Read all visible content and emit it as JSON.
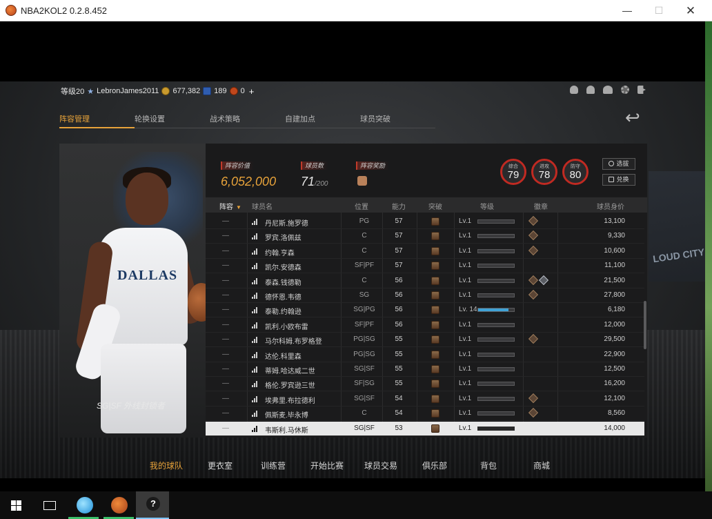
{
  "window": {
    "title": "NBA2KOL2 0.2.8.452",
    "minimize": "—",
    "maximize": "☐",
    "close": "✕"
  },
  "status": {
    "level": "等级20",
    "username": "LebronJames2011",
    "gold": "677,382",
    "stars": "189",
    "tokens": "0",
    "plus": "+"
  },
  "tabs": [
    {
      "label": "阵容管理"
    },
    {
      "label": "轮换设置"
    },
    {
      "label": "战术策略"
    },
    {
      "label": "自建加点"
    },
    {
      "label": "球员突破"
    }
  ],
  "player_card": {
    "jersey": "DALLAS",
    "role": "SG|SF 外线封锁者"
  },
  "summary": {
    "value_label": "阵容价值",
    "value": "6,052,000",
    "count_label": "球员数",
    "count": "71",
    "count_max": "/200",
    "reward_label": "阵容奖励"
  },
  "gauges": [
    {
      "label": "综合",
      "value": "79"
    },
    {
      "label": "进攻",
      "value": "78"
    },
    {
      "label": "防守",
      "value": "80"
    }
  ],
  "buttons": {
    "select": "选拔",
    "exchange": "兑换"
  },
  "table_headers": {
    "lineup": "阵容",
    "name": "球员名",
    "position": "位置",
    "ability": "能力",
    "breakthrough": "突破",
    "grade": "等级",
    "badge": "徽章",
    "value": "球员身价"
  },
  "rows": [
    {
      "dash": "—",
      "name": "丹尼斯.施罗德",
      "pos": "PG",
      "ovr": "57",
      "lvl": "Lv.1",
      "bar": 0,
      "badges": [
        "bronze"
      ],
      "salary": "13,100"
    },
    {
      "dash": "—",
      "name": "罗宾.洛佩兹",
      "pos": "C",
      "ovr": "57",
      "lvl": "Lv.1",
      "bar": 0,
      "badges": [
        "bronze"
      ],
      "salary": "9,330"
    },
    {
      "dash": "—",
      "name": "约翰.亨森",
      "pos": "C",
      "ovr": "57",
      "lvl": "Lv.1",
      "bar": 0,
      "badges": [
        "bronze"
      ],
      "salary": "10,600"
    },
    {
      "dash": "—",
      "name": "凯尔.安德森",
      "pos": "SF|PF",
      "ovr": "57",
      "lvl": "Lv.1",
      "bar": 0,
      "badges": [],
      "salary": "11,100"
    },
    {
      "dash": "—",
      "name": "泰森.钱德勒",
      "pos": "C",
      "ovr": "56",
      "lvl": "Lv.1",
      "bar": 0,
      "badges": [
        "bronze",
        "silver"
      ],
      "salary": "21,500"
    },
    {
      "dash": "—",
      "name": "德怀恩.韦德",
      "pos": "SG",
      "ovr": "56",
      "lvl": "Lv.1",
      "bar": 0,
      "badges": [
        "bronze"
      ],
      "salary": "27,800"
    },
    {
      "dash": "—",
      "name": "泰勒.约翰逊",
      "pos": "SG|PG",
      "ovr": "56",
      "lvl": "Lv. 14",
      "bar": 0.85,
      "badges": [],
      "salary": "6,180"
    },
    {
      "dash": "—",
      "name": "凯利.小欧布雷",
      "pos": "SF|PF",
      "ovr": "56",
      "lvl": "Lv.1",
      "bar": 0,
      "badges": [],
      "salary": "12,000"
    },
    {
      "dash": "—",
      "name": "马尔科姆.布罗格登",
      "pos": "PG|SG",
      "ovr": "55",
      "lvl": "Lv.1",
      "bar": 0,
      "badges": [
        "bronze"
      ],
      "salary": "29,500"
    },
    {
      "dash": "—",
      "name": "达伦.科里森",
      "pos": "PG|SG",
      "ovr": "55",
      "lvl": "Lv.1",
      "bar": 0,
      "badges": [],
      "salary": "22,900"
    },
    {
      "dash": "—",
      "name": "蒂姆.哈达威二世",
      "pos": "SG|SF",
      "ovr": "55",
      "lvl": "Lv.1",
      "bar": 0,
      "badges": [],
      "salary": "12,500"
    },
    {
      "dash": "—",
      "name": "格伦.罗宾逊三世",
      "pos": "SF|SG",
      "ovr": "55",
      "lvl": "Lv.1",
      "bar": 0,
      "badges": [],
      "salary": "16,200"
    },
    {
      "dash": "—",
      "name": "埃弗里.布拉德利",
      "pos": "SG|SF",
      "ovr": "54",
      "lvl": "Lv.1",
      "bar": 0,
      "badges": [
        "bronze"
      ],
      "salary": "12,100"
    },
    {
      "dash": "—",
      "name": "佩斯麦.毕永博",
      "pos": "C",
      "ovr": "54",
      "lvl": "Lv.1",
      "bar": 0,
      "badges": [
        "bronze"
      ],
      "salary": "8,560"
    },
    {
      "dash": "—",
      "name": "韦斯利.马休斯",
      "pos": "SG|SF",
      "ovr": "53",
      "lvl": "Lv.1",
      "bar": 0,
      "badges": [],
      "salary": "14,000",
      "selected": true
    }
  ],
  "bottom_nav": [
    {
      "label": "我的球队",
      "active": true
    },
    {
      "label": "更衣室"
    },
    {
      "label": "训练营"
    },
    {
      "label": "开始比赛"
    },
    {
      "label": "球员交易"
    },
    {
      "label": "俱乐部"
    },
    {
      "label": "背包"
    },
    {
      "label": "商城"
    }
  ],
  "background": {
    "banner_text": "LOUD CITY"
  },
  "taskbar": {
    "help": "?"
  }
}
